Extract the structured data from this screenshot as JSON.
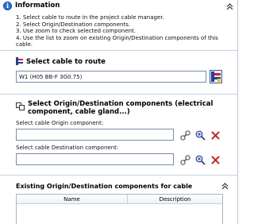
{
  "info": {
    "title": "Information",
    "steps": [
      "1. Select cable to route in the project cable manager.",
      "2. Select Origin/Destination components.",
      "3. Use zoom to check selected component.",
      "4. Use the list to zoom on existing Origin/Destination components of this cable."
    ]
  },
  "cable": {
    "title": "Select cable to route",
    "value": "W1 (H05 BB-F 3G0.75)"
  },
  "origin_destination": {
    "title": "Select Origin/Destination components (electrical component, cable gland...)",
    "origin_label": "Select cable Origin component:",
    "origin_value": "",
    "destination_label": "Select cable Destination component:",
    "destination_value": ""
  },
  "existing": {
    "title": "Existing Origin/Destination components for cable",
    "columns": [
      "Name",
      "Description"
    ]
  },
  "colors": {
    "accent": "#2c6ed5",
    "delete": "#c0282d",
    "border": "#7a8da8"
  }
}
